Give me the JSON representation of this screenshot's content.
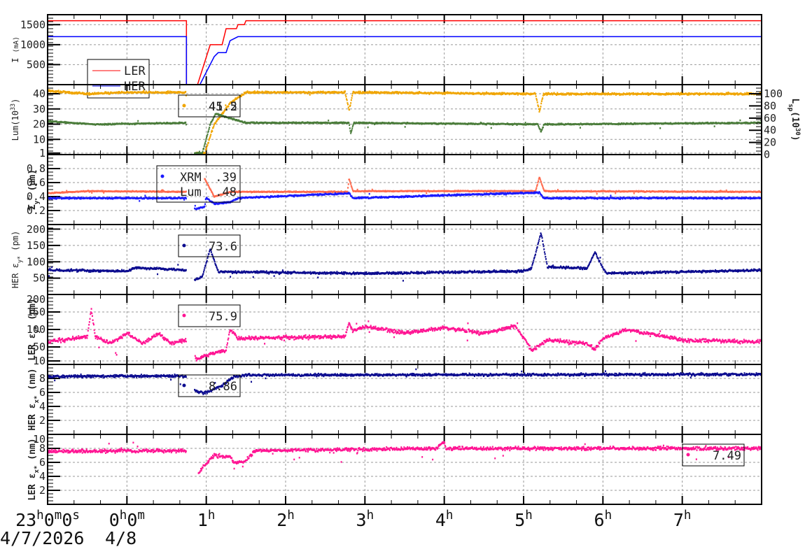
{
  "x_axis": {
    "range_hours_from_start": [
      0,
      9
    ],
    "tick_labels": [
      [
        {
          "t": "23"
        },
        {
          "s": "h"
        },
        {
          "t": "0"
        },
        {
          "s": "m"
        },
        {
          "t": "0"
        },
        {
          "s": "s"
        }
      ],
      [
        {
          "t": "0"
        },
        {
          "s": "h"
        },
        {
          "t": "0"
        },
        {
          "s": "m"
        }
      ],
      [
        {
          "t": "1"
        },
        {
          "s": "h"
        }
      ],
      [
        {
          "t": "2"
        },
        {
          "s": "h"
        }
      ],
      [
        {
          "t": "3"
        },
        {
          "s": "h"
        }
      ],
      [
        {
          "t": "4"
        },
        {
          "s": "h"
        }
      ],
      [
        {
          "t": "5"
        },
        {
          "s": "h"
        }
      ],
      [
        {
          "t": "6"
        },
        {
          "s": "h"
        }
      ],
      [
        {
          "t": "7"
        },
        {
          "s": "h"
        }
      ]
    ],
    "date_labels": [
      "4/7/2026",
      "4/8"
    ]
  },
  "colors": {
    "LER_I": "#ff0000",
    "HER_I": "#0000ff",
    "lum_orange": "#f0a500",
    "lum_green": "#4b7d3b",
    "sig_lum": "#ff6a4d",
    "sig_xrm": "#1a1aff",
    "navy": "#0b0b8f",
    "pink": "#ff1493"
  },
  "chart_data": [
    {
      "type": "line",
      "id": "current",
      "ylabel": [
        {
          "t": "I "
        },
        {
          "sm": "(mA)"
        }
      ],
      "ylim": [
        0,
        1750
      ],
      "yticks": [
        500,
        1000,
        1500
      ],
      "ytick_labels": [
        "500",
        "1000",
        "1500"
      ],
      "legend": {
        "entries": [
          {
            "label": "LER",
            "color": "#ff0000"
          },
          {
            "label": "HER",
            "color": "#0000ff"
          }
        ]
      },
      "series": [
        {
          "name": "LER",
          "color": "#ff0000",
          "style": "line",
          "noise": 0,
          "points": [
            [
              0,
              1600
            ],
            [
              1.75,
              1600
            ],
            [
              1.75,
              0
            ],
            [
              1.89,
              0
            ],
            [
              2.05,
              1000
            ],
            [
              2.2,
              1000
            ],
            [
              2.25,
              1400
            ],
            [
              2.38,
              1400
            ],
            [
              2.4,
              1500
            ],
            [
              2.48,
              1500
            ],
            [
              2.5,
              1600
            ],
            [
              9,
              1600
            ]
          ]
        },
        {
          "name": "HER",
          "color": "#0000ff",
          "style": "line",
          "noise": 0,
          "points": [
            [
              0,
              1200
            ],
            [
              1.75,
              1200
            ],
            [
              1.75,
              0
            ],
            [
              1.92,
              0
            ],
            [
              2.1,
              700
            ],
            [
              2.15,
              800
            ],
            [
              2.25,
              800
            ],
            [
              2.3,
              1100
            ],
            [
              2.4,
              1200
            ],
            [
              9,
              1200
            ]
          ]
        }
      ]
    },
    {
      "type": "scatter",
      "id": "luminosity",
      "ylabel": [
        {
          "t": "Lum(10"
        },
        {
          "sup": "33"
        },
        {
          "t": ")"
        }
      ],
      "ylim": [
        0,
        46
      ],
      "yticks": [
        1,
        10,
        20,
        30,
        40
      ],
      "ytick_labels": [
        "1",
        "10",
        "20",
        "30",
        "40"
      ],
      "y2": {
        "label": [
          {
            "t": "L"
          },
          {
            "sub": "sp"
          },
          {
            "t": "(10"
          },
          {
            "sup": "30"
          },
          {
            "t": ")"
          }
        ],
        "ylim": [
          0,
          115
        ],
        "yticks": [
          0,
          20,
          40,
          60,
          80,
          100
        ],
        "ytick_labels": [
          "0",
          "20",
          "40",
          "60",
          "80",
          "100"
        ]
      },
      "legend": {
        "values": [
          "41.5",
          "45.2"
        ],
        "marker_color": "#f0a500"
      },
      "series": [
        {
          "name": "Lum",
          "color": "#f0a500",
          "noise": 0.9,
          "gaps": [
            [
              1.75,
              1.87
            ]
          ],
          "points": [
            [
              0,
              42
            ],
            [
              0.5,
              40
            ],
            [
              1,
              41
            ],
            [
              1.74,
              41
            ],
            [
              1.87,
              1
            ],
            [
              1.98,
              1
            ],
            [
              2.1,
              20
            ],
            [
              2.3,
              34
            ],
            [
              2.5,
              41
            ],
            [
              3.75,
              41
            ],
            [
              3.8,
              29
            ],
            [
              3.85,
              41
            ],
            [
              6.15,
              40
            ],
            [
              6.2,
              28
            ],
            [
              6.25,
              40
            ],
            [
              9,
              40
            ]
          ]
        },
        {
          "name": "Lsp",
          "color": "#4b7d3b",
          "noise": 0.6,
          "gaps": [
            [
              1.75,
              1.85
            ]
          ],
          "points": [
            [
              0,
              22
            ],
            [
              0.6,
              20
            ],
            [
              1.74,
              21
            ],
            [
              1.85,
              1
            ],
            [
              1.95,
              1
            ],
            [
              2.05,
              20
            ],
            [
              2.12,
              27
            ],
            [
              2.3,
              24
            ],
            [
              2.5,
              21
            ],
            [
              3.8,
              21
            ],
            [
              3.82,
              14
            ],
            [
              3.86,
              21
            ],
            [
              6.18,
              20
            ],
            [
              6.22,
              15
            ],
            [
              6.26,
              20
            ],
            [
              9,
              21
            ]
          ]
        }
      ]
    },
    {
      "type": "scatter",
      "id": "sigma_y",
      "ylabel": [
        {
          "t": "Σ"
        },
        {
          "sub": "y"
        },
        {
          "sup": "*"
        },
        {
          "t": " (μm)"
        }
      ],
      "bold": true,
      "ylim": [
        0,
        1
      ],
      "yticks": [
        0.2,
        0.4,
        0.6,
        0.8
      ],
      "ytick_labels": [
        "0.2",
        "0.4",
        "0.6",
        "0.8"
      ],
      "legend": {
        "entries": [
          {
            "label": "XRM",
            "value": ".39",
            "color": "#1a1aff"
          },
          {
            "label": "Lum",
            "value": ".48",
            "color": "#ff6a4d"
          }
        ]
      },
      "series": [
        {
          "name": "Lum",
          "color": "#ff6a4d",
          "noise": 0.01,
          "gaps": [
            [
              1.75,
              1.98
            ]
          ],
          "points": [
            [
              0,
              0.45
            ],
            [
              0.5,
              0.48
            ],
            [
              1.74,
              0.47
            ],
            [
              1.98,
              0.66
            ],
            [
              2.1,
              0.4
            ],
            [
              2.3,
              0.47
            ],
            [
              3.78,
              0.47
            ],
            [
              3.8,
              0.66
            ],
            [
              3.85,
              0.48
            ],
            [
              6.15,
              0.48
            ],
            [
              6.2,
              0.68
            ],
            [
              6.26,
              0.48
            ],
            [
              9,
              0.47
            ]
          ]
        },
        {
          "name": "XRM",
          "color": "#1a1aff",
          "noise": 0.015,
          "gaps": [
            [
              1.75,
              1.85
            ]
          ],
          "points": [
            [
              0,
              0.38
            ],
            [
              1.74,
              0.38
            ],
            [
              1.86,
              0.22
            ],
            [
              1.98,
              0.26
            ],
            [
              2.0,
              0.38
            ],
            [
              2.1,
              0.3
            ],
            [
              2.3,
              0.32
            ],
            [
              2.4,
              0.38
            ],
            [
              3.8,
              0.45
            ],
            [
              3.85,
              0.38
            ],
            [
              6.2,
              0.46
            ],
            [
              6.25,
              0.38
            ],
            [
              9,
              0.38
            ]
          ]
        }
      ]
    },
    {
      "type": "scatter",
      "id": "her_emit_y",
      "ylabel": [
        {
          "t": "HER ε"
        },
        {
          "sub": "y*"
        },
        {
          "t": " (pm)"
        }
      ],
      "ylim": [
        0,
        214
      ],
      "yticks": [
        50,
        100,
        150,
        200
      ],
      "ytick_labels": [
        "50",
        "100",
        "150",
        "200"
      ],
      "legend": {
        "values": [
          "73.6"
        ],
        "marker_color": "#0b0b8f"
      },
      "series": [
        {
          "name": "HER εy*",
          "color": "#0b0b8f",
          "noise": 5,
          "gaps": [
            [
              1.75,
              1.85
            ]
          ],
          "points": [
            [
              0,
              75
            ],
            [
              1,
              72
            ],
            [
              1.1,
              82
            ],
            [
              1.5,
              78
            ],
            [
              1.74,
              75
            ],
            [
              1.86,
              45
            ],
            [
              1.95,
              55
            ],
            [
              2.05,
              140
            ],
            [
              2.15,
              70
            ],
            [
              4,
              65
            ],
            [
              6,
              72
            ],
            [
              6.1,
              80
            ],
            [
              6.22,
              190
            ],
            [
              6.3,
              85
            ],
            [
              6.8,
              80
            ],
            [
              6.9,
              130
            ],
            [
              7.0,
              80
            ],
            [
              7.05,
              65
            ],
            [
              9,
              75
            ]
          ]
        }
      ]
    },
    {
      "type": "scatter",
      "id": "ler_emit_y",
      "ylabel": [
        {
          "t": "LER ε"
        },
        {
          "sub": "y*"
        },
        {
          "t": " (pm)"
        }
      ],
      "bold": true,
      "ylim": [
        0,
        200
      ],
      "yticks": [
        10,
        50,
        100,
        150,
        200
      ],
      "ytick_labels": [
        "10",
        "50",
        "100",
        "150",
        "200"
      ],
      "legend": {
        "values": [
          "75.9"
        ],
        "marker_color": "#ff1493"
      },
      "series": [
        {
          "name": "LER εy*",
          "color": "#ff1493",
          "noise": 8,
          "gaps": [
            [
              1.75,
              1.86
            ]
          ],
          "points": [
            [
              0,
              65
            ],
            [
              0.5,
              80
            ],
            [
              0.55,
              160
            ],
            [
              0.6,
              80
            ],
            [
              0.8,
              60
            ],
            [
              1.0,
              90
            ],
            [
              1.2,
              60
            ],
            [
              1.4,
              90
            ],
            [
              1.55,
              60
            ],
            [
              1.74,
              70
            ],
            [
              1.87,
              15
            ],
            [
              2.1,
              35
            ],
            [
              2.25,
              40
            ],
            [
              2.3,
              100
            ],
            [
              2.4,
              75
            ],
            [
              3.75,
              80
            ],
            [
              3.8,
              120
            ],
            [
              3.85,
              95
            ],
            [
              4,
              110
            ],
            [
              4.5,
              90
            ],
            [
              5,
              105
            ],
            [
              5.5,
              90
            ],
            [
              5.9,
              110
            ],
            [
              6.05,
              60
            ],
            [
              6.1,
              40
            ],
            [
              6.3,
              70
            ],
            [
              6.8,
              60
            ],
            [
              6.9,
              45
            ],
            [
              7,
              75
            ],
            [
              7.3,
              100
            ],
            [
              8,
              70
            ],
            [
              9,
              65
            ]
          ]
        }
      ]
    },
    {
      "type": "scatter",
      "id": "her_emit_x",
      "ylabel": [
        {
          "t": "HER ε"
        },
        {
          "sub": "x*"
        },
        {
          "t": " (nm)"
        }
      ],
      "bold": true,
      "ylim": [
        0,
        10
      ],
      "yticks": [
        2,
        4,
        6,
        8
      ],
      "ytick_labels": [
        "2",
        "4",
        "6",
        "8"
      ],
      "legend": {
        "values": [
          "8.86"
        ],
        "marker_color": "#0b0b8f"
      },
      "series": [
        {
          "name": "HER εx*",
          "color": "#0b0b8f",
          "noise": 0.25,
          "gaps": [
            [
              1.75,
              1.85
            ]
          ],
          "points": [
            [
              0,
              8.3
            ],
            [
              1.74,
              8.4
            ],
            [
              1.86,
              6.2
            ],
            [
              2.0,
              6
            ],
            [
              2.2,
              7
            ],
            [
              2.35,
              8.3
            ],
            [
              2.5,
              8.5
            ],
            [
              9,
              8.6
            ]
          ]
        }
      ]
    },
    {
      "type": "scatter",
      "id": "ler_emit_x",
      "ylabel": [
        {
          "t": "LER ε"
        },
        {
          "sub": "x*"
        },
        {
          "t": " (nm)"
        }
      ],
      "bold": true,
      "ylim": [
        0,
        10
      ],
      "yticks": [
        2,
        4,
        6,
        8,
        10
      ],
      "ytick_labels": [
        "2",
        "4",
        "6",
        "8",
        "10"
      ],
      "legend": {
        "values": [
          "7.49"
        ],
        "marker_color": "#ff1493"
      },
      "series": [
        {
          "name": "LER εx*",
          "color": "#ff1493",
          "noise": 0.35,
          "gaps": [
            [
              1.75,
              1.9
            ]
          ],
          "points": [
            [
              0,
              7.6
            ],
            [
              1.74,
              7.7
            ],
            [
              1.9,
              4.5
            ],
            [
              2.05,
              6.5
            ],
            [
              2.1,
              7
            ],
            [
              2.3,
              6.8
            ],
            [
              2.35,
              6
            ],
            [
              2.5,
              6.2
            ],
            [
              2.55,
              7
            ],
            [
              2.62,
              7.7
            ],
            [
              4.9,
              8
            ],
            [
              5.0,
              9
            ],
            [
              5.02,
              8
            ],
            [
              9,
              8
            ]
          ]
        }
      ]
    }
  ]
}
